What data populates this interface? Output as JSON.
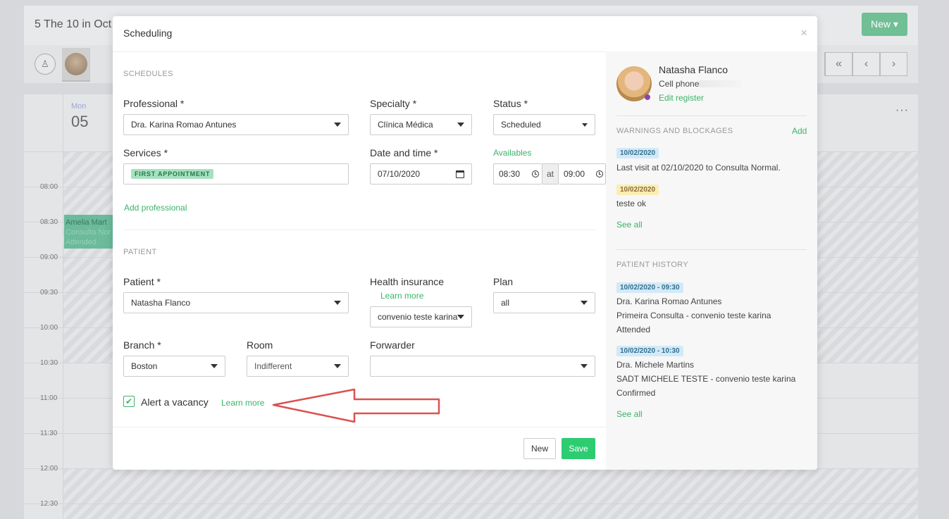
{
  "background": {
    "calendar_title": "5 The 10 in Oct",
    "new_button": "New ▾",
    "nav_buttons": [
      "«",
      "‹",
      "›"
    ],
    "day_name": "Mon",
    "day_number": "05",
    "more_icon": "···",
    "times": [
      "08:00",
      "08:30",
      "09:00",
      "09:30",
      "10:00",
      "10:30",
      "11:00",
      "11:30",
      "12:00",
      "12:30"
    ],
    "event": {
      "name": "Amelia Mart",
      "service": "Consulta Nor",
      "status": "Attended"
    }
  },
  "modal": {
    "title": "Scheduling",
    "close": "×",
    "schedules_section": "SCHEDULES",
    "professional": {
      "label": "Professional *",
      "value": "Dra. Karina Romao Antunes"
    },
    "specialty": {
      "label": "Specialty *",
      "value": "Clínica Médica"
    },
    "status": {
      "label": "Status *",
      "value": "Scheduled"
    },
    "services": {
      "label": "Services *",
      "tag": "FIRST APPOINTMENT"
    },
    "date_time": {
      "label": "Date and time *",
      "date": "07/10/2020",
      "start": "08:30",
      "at": "at",
      "end": "09:00"
    },
    "availables_link": "Availables",
    "add_professional_link": "Add professional",
    "patient_section": "PATIENT",
    "patient": {
      "label": "Patient *",
      "value": "Natasha Flanco"
    },
    "health_insurance": {
      "label": "Health insurance",
      "learn_more": "Learn more",
      "value": "convenio teste karina"
    },
    "plan": {
      "label": "Plan",
      "value": "all"
    },
    "branch": {
      "label": "Branch *",
      "value": "Boston"
    },
    "room": {
      "label": "Room",
      "value": "Indifferent"
    },
    "forwarder": {
      "label": "Forwarder",
      "value": ""
    },
    "alert_vacancy": {
      "label": "Alert a vacancy",
      "checked": "✔",
      "learn_more": "Learn more"
    },
    "buttons": {
      "new": "New",
      "save": "Save"
    }
  },
  "sidebar": {
    "patient_name": "Natasha Flanco",
    "cell_phone_label": "Cell phone",
    "edit_register": "Edit register",
    "warnings_title": "WARNINGS AND BLOCKAGES",
    "warnings_add": "Add",
    "warnings": [
      {
        "date": "10/02/2020",
        "text": "Last visit at 02/10/2020 to Consulta Normal."
      },
      {
        "date": "10/02/2020",
        "text": "teste ok"
      }
    ],
    "warnings_see_all": "See all",
    "history_title": "PATIENT HISTORY",
    "history": [
      {
        "date": "10/02/2020 - 09:30",
        "professional": "Dra. Karina Romao Antunes",
        "service": "Primeira Consulta - convenio teste karina",
        "status": "Attended"
      },
      {
        "date": "10/02/2020 - 10:30",
        "professional": "Dra. Michele Martins",
        "service": "SADT MICHELE TESTE - convenio teste karina",
        "status": "Confirmed"
      }
    ],
    "history_see_all": "See all"
  },
  "colors": {
    "accent_green": "#3bb36a",
    "annotation_arrow": "#d9534f"
  }
}
